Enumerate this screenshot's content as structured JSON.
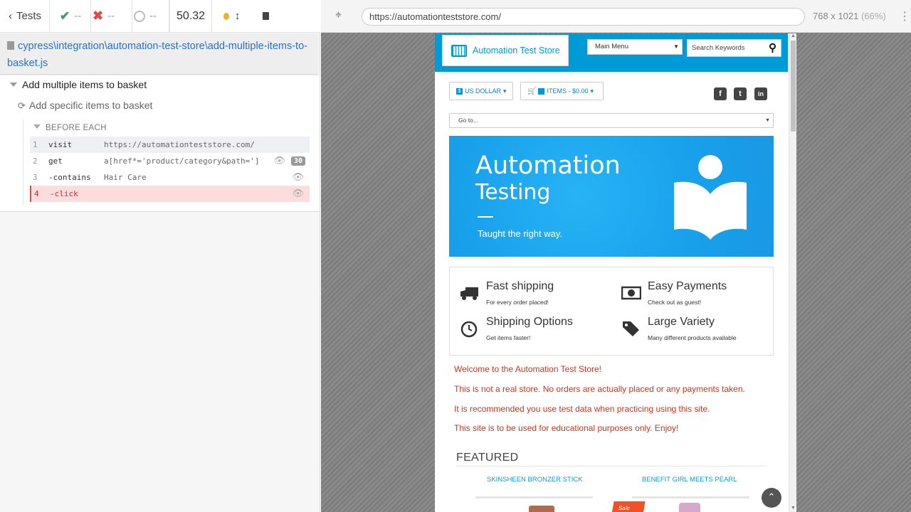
{
  "runner": {
    "tests_label": "Tests",
    "passed": "--",
    "failed": "--",
    "pending": "--",
    "duration": "50.32",
    "spec_path": "cypress\\integration\\automation-test-store\\add-multiple-items-to-basket.js",
    "suite_title": "Add multiple items to basket",
    "test_title": "Add specific items to basket",
    "hook_title": "BEFORE EACH",
    "commands": [
      {
        "num": "1",
        "name": "visit",
        "message": "https://automationteststore.com/",
        "badge": ""
      },
      {
        "num": "2",
        "name": "get",
        "message": "a[href*='product/category&path=']",
        "badge": "30"
      },
      {
        "num": "3",
        "name": "-contains",
        "message": "Hair Care",
        "badge": ""
      },
      {
        "num": "4",
        "name": "-click",
        "message": "",
        "badge": ""
      }
    ]
  },
  "aut": {
    "url": "https://automationteststore.com/",
    "viewport": "768 x 1021",
    "zoom": "(66%)"
  },
  "site": {
    "logo_text": "Automation Test Store",
    "main_menu": "Main Menu",
    "search_placeholder": "Search Keywords",
    "currency": "US DOLLAR",
    "cart": "ITEMS - $0.00",
    "goto": "Go to...",
    "banner": {
      "line1": "Automation",
      "line2": "Testing",
      "tagline": "Taught the right way."
    },
    "features": [
      {
        "title": "Fast shipping",
        "sub": "For every order placed!",
        "icon": "truck-icon"
      },
      {
        "title": "Easy Payments",
        "sub": "Check out as guest!",
        "icon": "money-icon"
      },
      {
        "title": "Shipping Options",
        "sub": "Get items faster!",
        "icon": "clock-icon"
      },
      {
        "title": "Large Variety",
        "sub": "Many different products available",
        "icon": "tags-icon"
      }
    ],
    "notices": [
      "Welcome to the Automation Test Store!",
      "This is not a real store. No orders are actually placed or any payments taken.",
      "It is recommended you use test data when practicing using this site.",
      "This site is to be used for educational purposes only. Enjoy!"
    ],
    "featured_heading": "FEATURED",
    "products": [
      "SKINSHEEN BRONZER STICK",
      "BENEFIT GIRL MEETS PEARL"
    ],
    "sale_label": "Sale"
  },
  "colors": {
    "accent": "#009ad6",
    "error": "#e04a4a",
    "notice": "#c4371e"
  }
}
